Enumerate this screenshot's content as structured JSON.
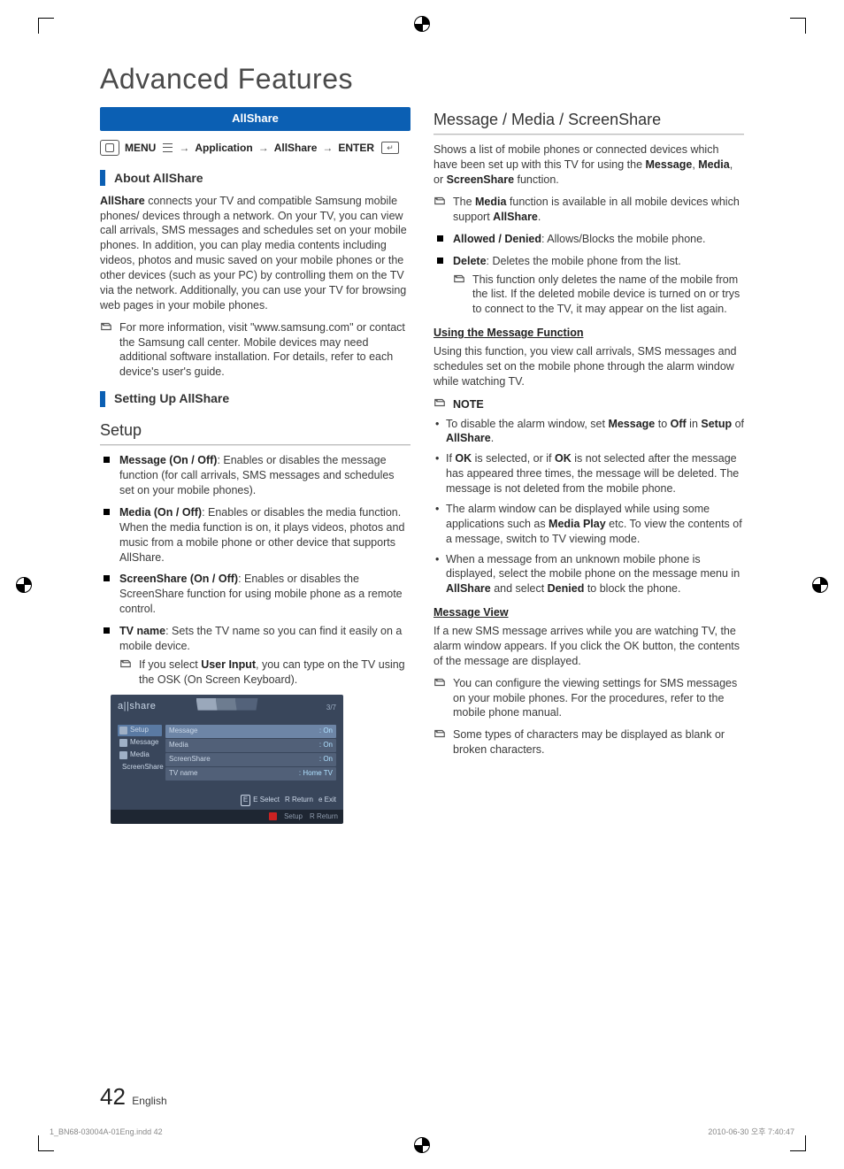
{
  "page_title": "Advanced Features",
  "page_number": "42",
  "page_lang": "English",
  "footer": {
    "file": "1_BN68-03004A-01Eng.indd   42",
    "timestamp": "2010-06-30   오후 7:40:47"
  },
  "left": {
    "blue_bar": "AllShare",
    "breadcrumb": {
      "menu": "MENU",
      "app": "Application",
      "allshare": "AllShare",
      "enter": "ENTER"
    },
    "about_heading": "About AllShare",
    "about_body": "AllShare connects your TV and compatible Samsung mobile phones/ devices through a network. On your TV, you can view call arrivals, SMS messages and schedules set on your mobile phones. In addition, you can play media contents including videos, photos and music saved on your mobile phones or the other devices (such as your PC) by controlling them on the TV via the network. Additionally, you can use your TV for browsing web pages in your mobile phones.",
    "about_note": "For more information, visit \"www.samsung.com\" or contact the Samsung call center. Mobile devices may need additional software installation. For details, refer to each device's user's guide.",
    "setting_heading": "Setting Up AllShare",
    "setup_h2": "Setup",
    "setup_items": [
      {
        "title": "Message (On / Off)",
        "text": ": Enables or disables the message function (for call arrivals, SMS messages and schedules set on your mobile phones)."
      },
      {
        "title": "Media (On / Off)",
        "text": ": Enables or disables the media function. When the media function is on, it plays videos, photos and music from a mobile phone or other device that supports AllShare."
      },
      {
        "title": "ScreenShare (On / Off)",
        "text": ": Enables or disables the ScreenShare function for using mobile phone as a remote control."
      },
      {
        "title": "TV name",
        "text": ": Sets the TV name so you can find it easily on a mobile device."
      }
    ],
    "tvname_note": "If you select User Input, you can type on the TV using the OSK (On Screen Keyboard).",
    "tvname_note_pre": "If you select ",
    "tvname_note_bold": "User Input",
    "tvname_note_post": ", you can type on the TV using the OSK (On Screen Keyboard).",
    "tv": {
      "brand": "a||share",
      "counter": "3/7",
      "left_items": [
        "Setup",
        "Message",
        "Media",
        "ScreenShare"
      ],
      "rows": [
        {
          "label": "Message",
          "value": ": On"
        },
        {
          "label": "Media",
          "value": ": On"
        },
        {
          "label": "ScreenShare",
          "value": ": On"
        },
        {
          "label": "TV name",
          "value": ": Home TV"
        }
      ],
      "actions": [
        "E Select",
        "R Return",
        "e Exit"
      ],
      "bottom_actions": [
        "Setup",
        "R Return"
      ]
    }
  },
  "right": {
    "h2": "Message / Media / ScreenShare",
    "intro_pre": "Shows a list of mobile phones or connected devices which have been set up with this TV for using the ",
    "intro_bold1": "Message",
    "intro_mid1": ", ",
    "intro_bold2": "Media",
    "intro_mid2": ", or ",
    "intro_bold3": "ScreenShare",
    "intro_post": " function.",
    "media_note": "The Media function is available in all mobile devices which support AllShare.",
    "list": [
      {
        "title": "Allowed / Denied",
        "text": ": Allows/Blocks the mobile phone."
      },
      {
        "title": "Delete",
        "text": ": Deletes the mobile phone from the list."
      }
    ],
    "delete_note": "This function only deletes the name of the mobile from the list. If the deleted mobile device is turned on or trys to connect to the TV, it may appear on the list again.",
    "use_msg_h3": "Using the Message Function",
    "use_msg_body": "Using this function, you view call arrivals, SMS messages and schedules set on the mobile phone through the alarm window while watching TV.",
    "note_label": "NOTE",
    "note_bullets_html": [
      "To disable the alarm window, set <b>Message</b> to <b>Off</b> in <b>Setup</b> of <b>AllShare</b>.",
      "If <b>OK</b> is selected, or if <b>OK</b> is not selected after the message has appeared three times, the message will be deleted. The message is not deleted from the mobile phone.",
      "The alarm window can be displayed while using some applications such as <b>Media Play</b> etc. To view the contents of a message, switch to TV viewing mode.",
      "When a message from an unknown mobile phone is displayed, select the mobile phone on the message menu in <b>AllShare</b> and select <b>Denied</b> to block the phone."
    ],
    "msg_view_h3": "Message View",
    "msg_view_body": "If a new SMS message arrives while you are watching TV, the alarm window appears. If you click the OK button, the contents of the message are displayed.",
    "msg_view_notes": [
      "You can configure the viewing settings for SMS messages on your mobile phones. For the procedures, refer to the mobile phone manual.",
      "Some types of characters may be displayed as blank or broken characters."
    ]
  }
}
